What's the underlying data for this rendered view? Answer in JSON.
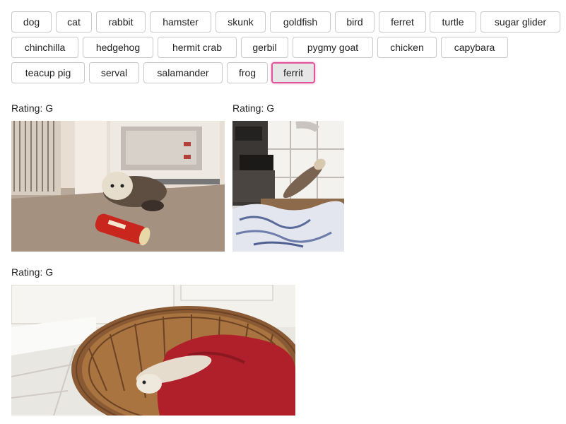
{
  "topics": [
    "dog",
    "cat",
    "rabbit",
    "hamster",
    "skunk",
    "goldfish",
    "bird",
    "ferret",
    "turtle",
    "sugar glider",
    "chinchilla",
    "hedgehog",
    "hermit crab",
    "gerbil",
    "pygmy goat",
    "chicken",
    "capybara",
    "teacup pig",
    "serval",
    "salamander",
    "frog",
    "ferrit"
  ],
  "active_topic": "ferrit",
  "results": [
    {
      "rating": "Rating: G",
      "image": "ferret-with-can-gif"
    },
    {
      "rating": "Rating: G",
      "image": "ferret-jumping-on-bed-gif"
    },
    {
      "rating": "Rating: G",
      "image": "ferret-in-basket-gif"
    }
  ],
  "colors": {
    "active_border": "#e0559a",
    "active_bg": "#e6e6e6",
    "button_border": "#c9c9c9"
  }
}
